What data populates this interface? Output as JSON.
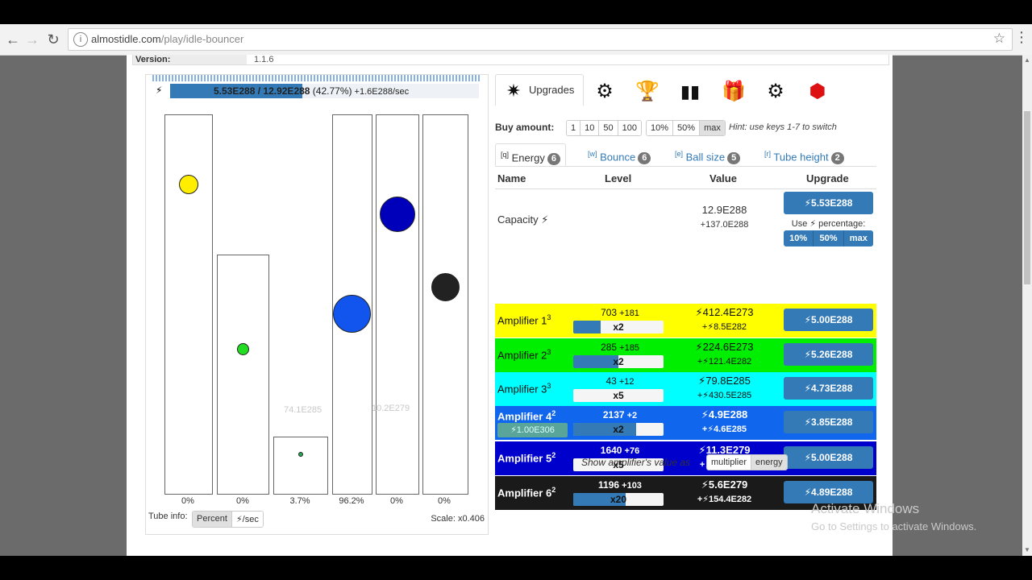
{
  "browser": {
    "url_host": "almostidle.com",
    "url_path": "/play/idle-bouncer",
    "back_icon": "←",
    "forward_icon": "→",
    "reload_icon": "↻",
    "info_icon": "i",
    "star_icon": "☆",
    "menu_icon": "⋮"
  },
  "version": {
    "label": "Version:",
    "value": "1.1.6"
  },
  "energy": {
    "bolt": "⚡",
    "current": "5.53E288",
    "sep": " / ",
    "capacity": "12.92E288",
    "percent": " (42.77%)",
    "rate": " +1.6E288/sec",
    "fill_pct": 42.77
  },
  "tubes": [
    {
      "label": "0%",
      "color": "#ffee00"
    },
    {
      "label": "0%",
      "color": "#22dd22"
    },
    {
      "label": "3.7%",
      "color": "#22aa55"
    },
    {
      "label": "96.2%",
      "color": "#1155ee"
    },
    {
      "label": "0%",
      "color": "#0000bb"
    },
    {
      "label": "0%",
      "color": "#222222"
    }
  ],
  "ghost_values": [
    "74.1E285",
    "10.2E279"
  ],
  "tube_info": {
    "label": "Tube info:",
    "percent": "Percent",
    "per_sec": "⚡/sec"
  },
  "scale": "Scale: x0.406",
  "upgrades_tab": {
    "label": "Upgrades"
  },
  "icons": [
    "upgrades-icon",
    "machine-icon",
    "trophy-icon",
    "stats-icon",
    "gift-icon",
    "settings-icon",
    "gem-icon"
  ],
  "buy": {
    "label": "Buy amount:",
    "options": [
      "1",
      "10",
      "50",
      "100"
    ],
    "pct_options": [
      "10%",
      "50%",
      "max"
    ],
    "hint": "Hint: use keys 1-7 to switch"
  },
  "subtabs": [
    {
      "key": "[q]",
      "label": "Energy",
      "count": "6"
    },
    {
      "key": "[w]",
      "label": "Bounce",
      "count": "6"
    },
    {
      "key": "[e]",
      "label": "Ball size",
      "count": "5"
    },
    {
      "key": "[r]",
      "label": "Tube height",
      "count": "2"
    }
  ],
  "table_headers": {
    "name": "Name",
    "level": "Level",
    "value": "Value",
    "upgrade": "Upgrade"
  },
  "capacity": {
    "name": "Capacity",
    "value": "12.9E288",
    "delta": "+137.0E288",
    "cost": "⚡5.53E288",
    "use_pct_label": "Use ⚡ percentage:",
    "pct": [
      "10%",
      "50%",
      "max"
    ]
  },
  "amplifiers": [
    {
      "name": "Amplifier 1",
      "sup": "3",
      "level": "703",
      "plus": " +181",
      "mult": "x2",
      "fill_pct": 30,
      "value": "⚡412.4E273",
      "delta": "+⚡8.5E282",
      "cost": "⚡5.00E288",
      "bg": "#ffff00",
      "fg": "#111111"
    },
    {
      "name": "Amplifier 2",
      "sup": "3",
      "level": "285",
      "plus": " +185",
      "mult": "x2",
      "fill_pct": 50,
      "value": "⚡224.6E273",
      "delta": "+⚡121.4E282",
      "cost": "⚡5.26E288",
      "bg": "#00ee00",
      "fg": "#111111"
    },
    {
      "name": "Amplifier 3",
      "sup": "3",
      "level": "43",
      "plus": " +12",
      "mult": "x5",
      "fill_pct": 0,
      "value": "⚡79.8E285",
      "delta": "+⚡430.5E285",
      "cost": "⚡4.73E288",
      "bg": "#00ffff",
      "fg": "#111111"
    },
    {
      "name": "Amplifier 4",
      "sup": "2",
      "level": "2137",
      "plus": " +2",
      "mult": "x2",
      "fill_pct": 70,
      "value": "⚡4.9E288",
      "delta": "+⚡4.6E285",
      "cost": "⚡3.85E288",
      "bg": "#1166ee",
      "fg": "#ffffff",
      "disabled_cost": "⚡1.00E306"
    },
    {
      "name": "Amplifier 5",
      "sup": "2",
      "level": "1640",
      "plus": " +76",
      "mult": "x5",
      "fill_pct": 0,
      "value": "⚡11.3E279",
      "delta": "+⚡37.8E282",
      "cost": "⚡5.00E288",
      "bg": "#0000cc",
      "fg": "#ffffff"
    },
    {
      "name": "Amplifier 6",
      "sup": "2",
      "level": "1196",
      "plus": " +103",
      "mult": "x20",
      "fill_pct": 58,
      "value": "⚡5.6E279",
      "delta": "+⚡154.4E282",
      "cost": "⚡4.89E288",
      "bg": "#1a1a1a",
      "fg": "#ffffff"
    }
  ],
  "show_row": {
    "label": "Show amplifier's value as",
    "multiplier": "multiplier",
    "energy": "energy"
  },
  "watermark": {
    "line1": "Activate Windows",
    "line2": "Go to Settings to activate Windows."
  }
}
